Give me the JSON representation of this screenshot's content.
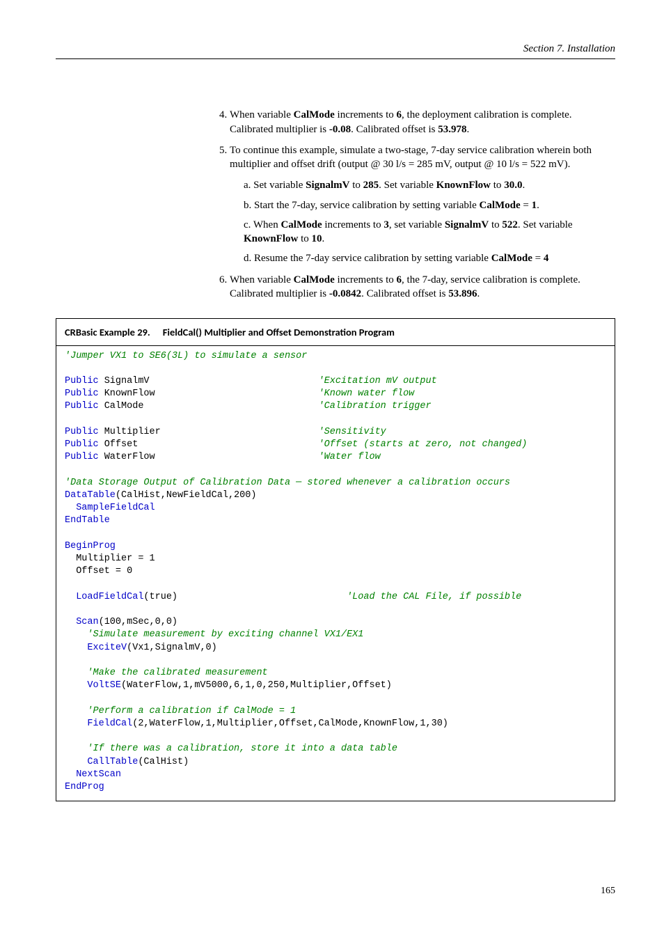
{
  "header": "Section 7.  Installation",
  "list": {
    "item4": {
      "p1a": "When variable ",
      "b1": "CalMode",
      "p1b": " increments to ",
      "b2": "6",
      "p1c": ", the deployment calibration is complete. Calibrated multiplier is ",
      "b3": "-0.08",
      "p1d": ". Calibrated offset is ",
      "b4": "53.978",
      "p1e": "."
    },
    "item5": {
      "p1": "To continue this example, simulate a two-stage, 7-day service calibration wherein both multiplier and offset drift (output @ 30 l/s = 285 mV, output @ 10 l/s = 522 mV).",
      "a": {
        "t1": "a.  Set variable ",
        "b1": "SignalmV",
        "t2": " to ",
        "b2": "285",
        "t3": ". Set variable ",
        "b3": "KnownFlow",
        "t4": " to ",
        "b4": "30.0",
        "t5": "."
      },
      "b": {
        "t1": "b.  Start the 7-day, service calibration by setting variable ",
        "b1": "CalMode",
        "t2": " = ",
        "b2": "1",
        "t3": "."
      },
      "c": {
        "t1": "c.  When ",
        "b1": "CalMode",
        "t2": " increments to ",
        "b2": "3",
        "t3": ", set variable ",
        "b3": "SignalmV",
        "t4": " to ",
        "b4": "522",
        "t5": ". Set variable ",
        "b5": "KnownFlow",
        "t6": " to ",
        "b6": "10",
        "t7": "."
      },
      "d": {
        "t1": "d.  Resume the 7-day service calibration by setting variable ",
        "b1": "CalMode",
        "t2": " = ",
        "b2": "4"
      }
    },
    "item6": {
      "p1a": "When variable ",
      "b1": "CalMode",
      "p1b": " increments to ",
      "b2": "6",
      "p1c": ", the 7-day, service calibration is complete. Calibrated multiplier is ",
      "b3": "-0.0842",
      "p1d": ". Calibrated offset is ",
      "b4": "53.896",
      "p1e": "."
    }
  },
  "codebox": {
    "label": "CRBasic Example 29.",
    "desc": "FieldCal() Multiplier and Offset Demonstration Program"
  },
  "code": {
    "l1": "'Jumper VX1 to SE6(3L) to simulate a sensor",
    "l3a": "Public",
    "l3b": " SignalmV                              ",
    "l3c": "'Excitation mV output",
    "l4a": "Public",
    "l4b": " KnownFlow                             ",
    "l4c": "'Known water flow",
    "l5a": "Public",
    "l5b": " CalMode                               ",
    "l5c": "'Calibration trigger",
    "l7a": "Public",
    "l7b": " Multiplier                            ",
    "l7c": "'Sensitivity",
    "l8a": "Public",
    "l8b": " Offset                                ",
    "l8c": "'Offset (starts at zero, not changed)",
    "l9a": "Public",
    "l9b": " WaterFlow                             ",
    "l9c": "'Water flow",
    "l11": "'Data Storage Output of Calibration Data ─ stored whenever a calibration occurs",
    "l12a": "DataTable",
    "l12b": "(CalHist,NewFieldCal,200)",
    "l13": "  SampleFieldCal",
    "l14": "EndTable",
    "l16": "BeginProg",
    "l17": "  Multiplier = 1",
    "l18": "  Offset = 0",
    "l20a": "  LoadFieldCal",
    "l20b": "(true)                              ",
    "l20c": "'Load the CAL File, if possible",
    "l22a": "  Scan",
    "l22b": "(100,mSec,0,0)",
    "l23": "    'Simulate measurement by exciting channel VX1/EX1",
    "l24a": "    ExciteV",
    "l24b": "(Vx1,SignalmV,0)",
    "l26": "    'Make the calibrated measurement",
    "l27a": "    VoltSE",
    "l27b": "(WaterFlow,1,mV5000,6,1,0,250,Multiplier,Offset)",
    "l29": "    'Perform a calibration if CalMode = 1",
    "l30a": "    FieldCal",
    "l30b": "(2,WaterFlow,1,Multiplier,Offset,CalMode,KnownFlow,1,30)",
    "l32": "    'If there was a calibration, store it into a data table",
    "l33a": "    CallTable",
    "l33b": "(CalHist)",
    "l34": "  NextScan",
    "l35": "EndProg"
  },
  "pageNum": "165"
}
